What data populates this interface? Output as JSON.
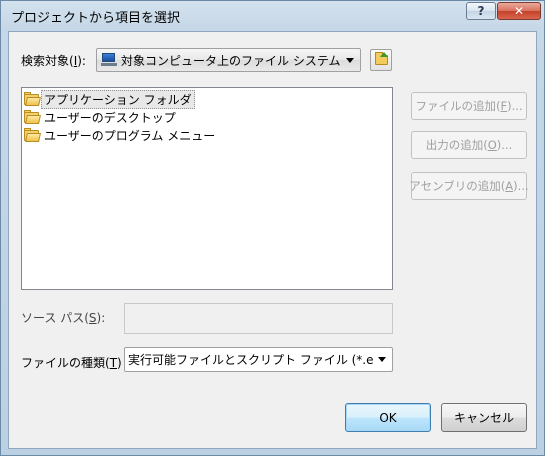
{
  "window": {
    "title": "プロジェクトから項目を選択",
    "help_glyph": "?",
    "close_glyph": "✕"
  },
  "lookin": {
    "label_pre": "検索対象(",
    "label_key": "I",
    "label_post": "):",
    "value": "対象コンピュータ上のファイル システム",
    "icon": "computer-icon",
    "up_icon": "folder-up-icon"
  },
  "list": {
    "items": [
      {
        "label": "アプリケーション フォルダ",
        "icon": "application-folder-icon"
      },
      {
        "label": "ユーザーのデスクトップ",
        "icon": "folder-icon"
      },
      {
        "label": "ユーザーのプログラム メニュー",
        "icon": "folder-icon"
      }
    ]
  },
  "side_buttons": {
    "add_file": {
      "pre": "ファイルの追加(",
      "key": "F",
      "post": ")..."
    },
    "add_output": {
      "pre": "出力の追加(",
      "key": "O",
      "post": ")..."
    },
    "add_assembly": {
      "pre": "アセンブリの追加(",
      "key": "A",
      "post": ")..."
    }
  },
  "source_path": {
    "label_pre": "ソース パス(",
    "label_key": "S",
    "label_post": "):",
    "value": ""
  },
  "file_type": {
    "label_pre": "ファイルの種類(",
    "label_key": "T",
    "label_post": ")",
    "value": "実行可能ファイルとスクリプト ファイル (*.e"
  },
  "buttons": {
    "ok": "OK",
    "cancel": "キャンセル"
  }
}
